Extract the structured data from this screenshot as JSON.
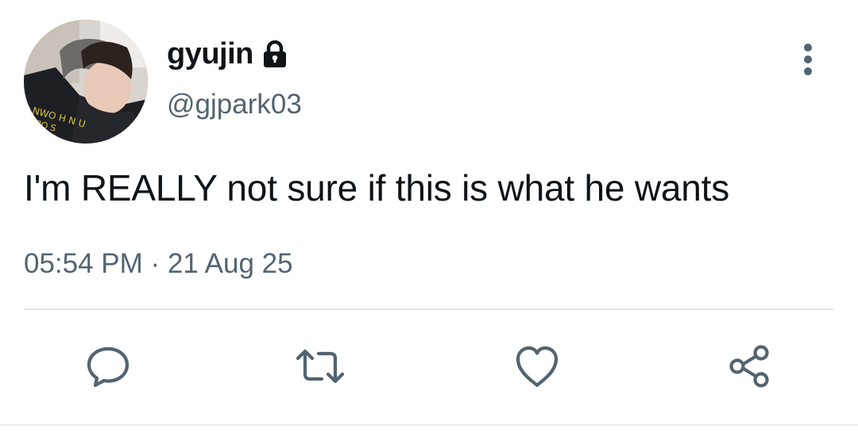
{
  "author": {
    "display_name": "gyujin",
    "handle": "@gjpark03",
    "protected": true
  },
  "tweet": {
    "text": "I'm REALLY not sure if this is what he wants",
    "time": "05:54 PM",
    "separator": "·",
    "date": "21 Aug 25"
  },
  "actions": [
    "reply-icon",
    "retweet-icon",
    "like-icon",
    "share-icon"
  ],
  "colors": {
    "text_primary": "#0f1419",
    "text_secondary": "#536471",
    "icon": "#536471",
    "divider": "#e6e9eb"
  }
}
